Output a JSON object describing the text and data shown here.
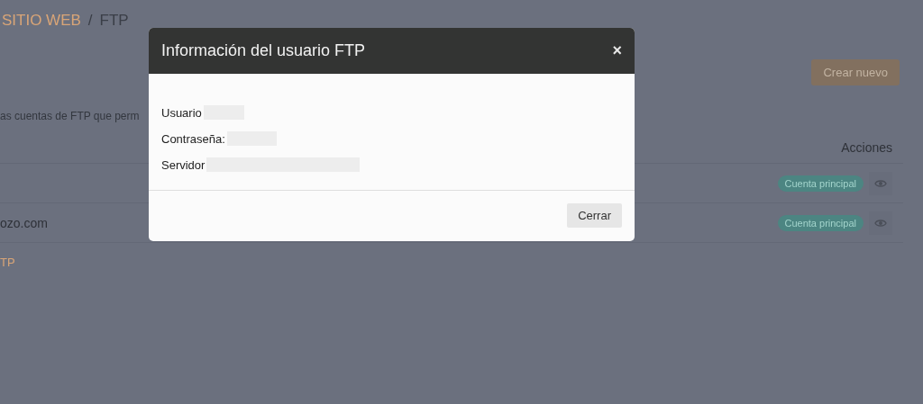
{
  "breadcrumb": {
    "section": "SITIO WEB",
    "separator": "/",
    "current": "FTP"
  },
  "create_button": "Crear nuevo",
  "description": "as cuentas de FTP que perm",
  "table": {
    "columns": [
      "Acciones"
    ],
    "rows": [
      {
        "name": "",
        "badge": "Cuenta principal"
      },
      {
        "name": "ozo.com",
        "badge": "Cuenta principal"
      }
    ]
  },
  "footer_link": "TP",
  "modal": {
    "title": "Información del usuario FTP",
    "close": "×",
    "fields": [
      {
        "label": "Usuario"
      },
      {
        "label": "Contraseña:"
      },
      {
        "label": "Servidor"
      }
    ],
    "button": "Cerrar"
  }
}
